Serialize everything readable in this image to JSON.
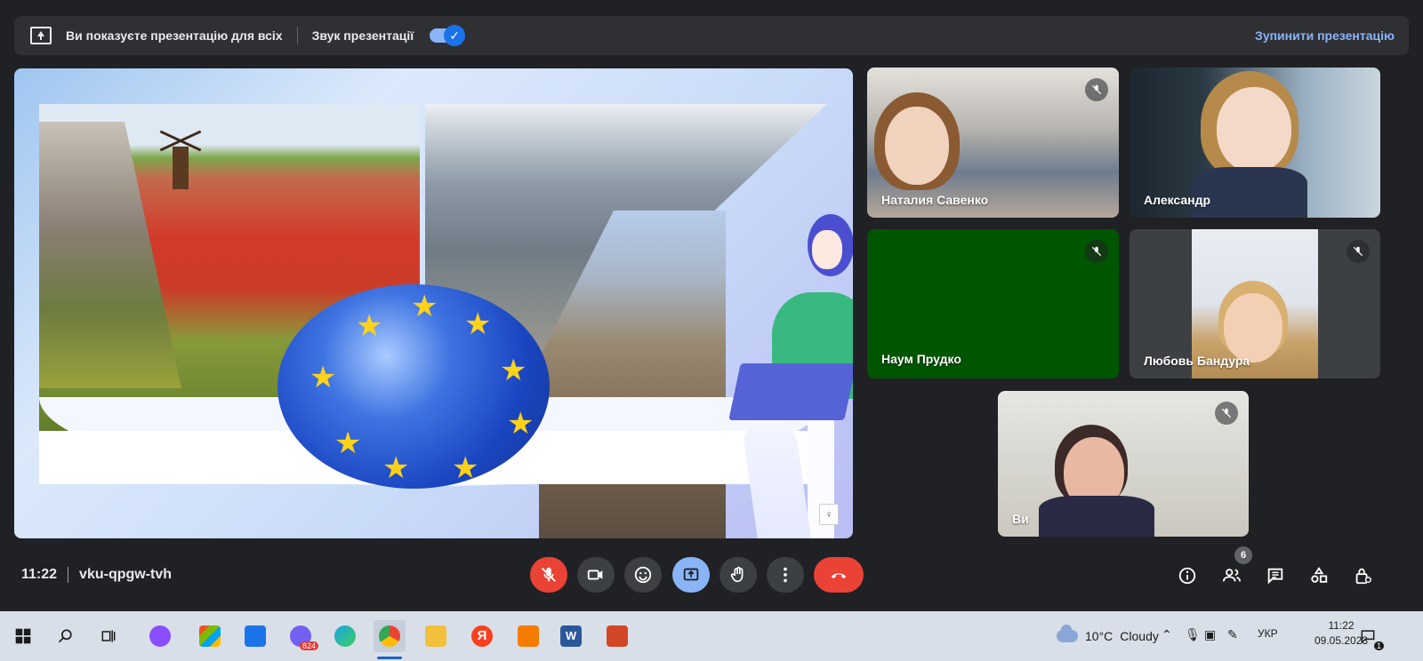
{
  "topbar": {
    "presenting_text": "Ви показуєте презентацію для всіх",
    "sound_label": "Звук презентації",
    "sound_on": true,
    "stop_label": "Зупинити презентацію"
  },
  "presentation": {
    "slide_badge": "♀"
  },
  "participants": [
    {
      "name": "Наталия Савенко",
      "muted": true
    },
    {
      "name": "Александр",
      "muted": false
    },
    {
      "name": "Наум Прудко",
      "muted": true
    },
    {
      "name": "Любовь Бандура",
      "muted": true
    },
    {
      "name": "Ви",
      "muted": true
    }
  ],
  "meeting": {
    "time": "11:22",
    "code": "vku-qpgw-tvh",
    "participant_count": "6"
  },
  "controls": {
    "mic": "mic-off-icon",
    "camera": "camera-icon",
    "reactions": "emoji-icon",
    "present": "present-icon",
    "hand": "raise-hand-icon",
    "more": "more-vert-icon",
    "leave": "end-call-icon"
  },
  "taskbar": {
    "weather_temp": "10°C",
    "weather_text": "Cloudy",
    "viber_badge": "824",
    "lang": "УКР",
    "clock_time": "11:22",
    "clock_date": "09.05.2023",
    "notif_count": "1"
  },
  "colors": {
    "background": "#202124",
    "red": "#ea4335",
    "blue": "#8ab4f8",
    "tile": "#3c4043",
    "green_tile": "#005500"
  }
}
